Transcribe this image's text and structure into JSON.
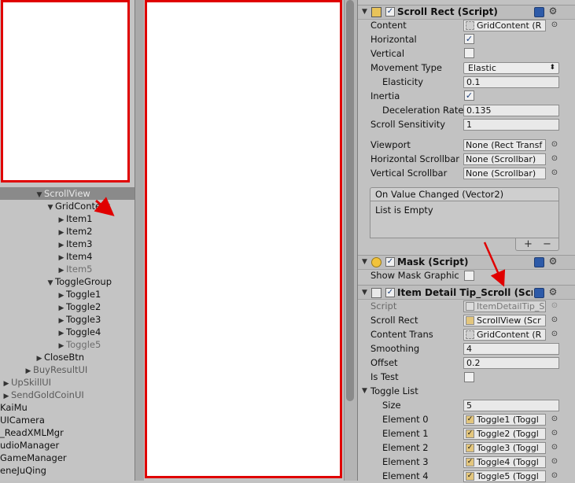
{
  "hierarchy": {
    "items": [
      {
        "label": "ScrollView",
        "expanded": true,
        "selected": true
      },
      {
        "label": "GridContent",
        "expanded": true
      },
      {
        "label": "Item1"
      },
      {
        "label": "Item2"
      },
      {
        "label": "Item3"
      },
      {
        "label": "Item4"
      },
      {
        "label": "Item5",
        "inactive": true
      },
      {
        "label": "ToggleGroup",
        "expanded": true
      },
      {
        "label": "Toggle1"
      },
      {
        "label": "Toggle2"
      },
      {
        "label": "Toggle3"
      },
      {
        "label": "Toggle4"
      },
      {
        "label": "Toggle5",
        "inactive": true
      },
      {
        "label": "CloseBtn"
      },
      {
        "label": "BuyResultUI",
        "inactive": true
      },
      {
        "label": "UpSkillUI",
        "inactive": true
      },
      {
        "label": "SendGoldCoinUI",
        "inactive": true
      },
      {
        "label": "KaiMu"
      },
      {
        "label": "UICamera"
      },
      {
        "label": "_ReadXMLMgr"
      },
      {
        "label": "udioManager"
      },
      {
        "label": "GameManager"
      },
      {
        "label": "eneJuQing"
      }
    ]
  },
  "inspector": {
    "scroll_rect": {
      "title": "Scroll Rect (Script)",
      "enabled": true,
      "content_label": "Content",
      "content_value": "GridContent (R",
      "horizontal_label": "Horizontal",
      "horizontal": true,
      "vertical_label": "Vertical",
      "vertical": false,
      "movement_type_label": "Movement Type",
      "movement_type": "Elastic",
      "elasticity_label": "Elasticity",
      "elasticity": "0.1",
      "inertia_label": "Inertia",
      "inertia": true,
      "deceleration_label": "Deceleration Rate",
      "deceleration": "0.135",
      "sensitivity_label": "Scroll Sensitivity",
      "sensitivity": "1",
      "viewport_label": "Viewport",
      "viewport": "None (Rect Transf",
      "hscrollbar_label": "Horizontal Scrollbar",
      "hscrollbar": "None (Scrollbar)",
      "vscrollbar_label": "Vertical Scrollbar",
      "vscrollbar": "None (Scrollbar)",
      "event_title": "On Value Changed (Vector2)",
      "event_empty": "List is Empty",
      "add_symbol": "+",
      "remove_symbol": "−"
    },
    "mask": {
      "title": "Mask (Script)",
      "enabled": true,
      "show_graphic_label": "Show Mask Graphic",
      "show_graphic": false
    },
    "item_detail": {
      "title": "Item Detail Tip_Scroll (Scr",
      "enabled": true,
      "script_label": "Script",
      "script_value": "ItemDetailTip_S",
      "scroll_rect_label": "Scroll Rect",
      "scroll_rect_value": "ScrollView (Scr",
      "content_trans_label": "Content Trans",
      "content_trans_value": "GridContent (R",
      "smoothing_label": "Smoothing",
      "smoothing": "4",
      "offset_label": "Offset",
      "offset": "0.2",
      "is_test_label": "Is Test",
      "is_test": false,
      "toggle_list_label": "Toggle List",
      "size_label": "Size",
      "size": "5",
      "elements": [
        {
          "label": "Element 0",
          "value": "Toggle1 (Toggl"
        },
        {
          "label": "Element 1",
          "value": "Toggle2 (Toggl"
        },
        {
          "label": "Element 2",
          "value": "Toggle3 (Toggl"
        },
        {
          "label": "Element 3",
          "value": "Toggle4 (Toggl"
        },
        {
          "label": "Element 4",
          "value": "Toggle5 (Toggl"
        }
      ]
    }
  },
  "icons": {
    "checkmark": "✓",
    "expand": "▼",
    "collapse": "▶",
    "picker": "⊙",
    "gear": "⚙",
    "dropdown": "⬍"
  },
  "colors": {
    "highlight_border": "#e00000",
    "annotation_arrow": "#e00000"
  }
}
